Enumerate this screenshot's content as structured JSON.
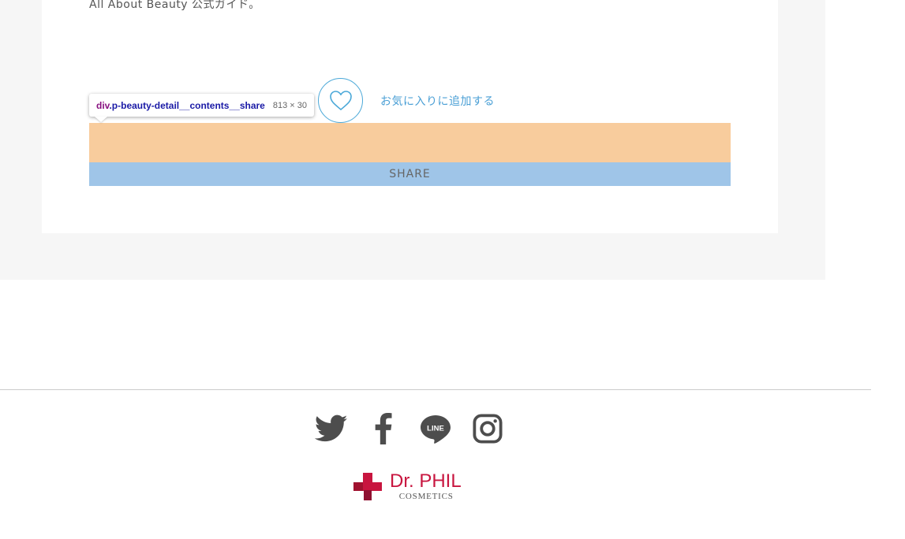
{
  "article": {
    "intro_text": "All About Beauty 公式ガイド。"
  },
  "favorite": {
    "label": "お気に入りに追加する",
    "icon": "heart-outline-icon",
    "accent_color": "#4a9fd5"
  },
  "share": {
    "label": "SHARE",
    "padding_color": "#f8cc9d",
    "bar_color": "#9fc5e8"
  },
  "inspector_tooltip": {
    "tag": "div",
    "class_name": ".p-beauty-detail__contents__share",
    "size": "813 × 30"
  },
  "footer": {
    "social_icons": [
      "twitter-icon",
      "facebook-icon",
      "line-icon",
      "instagram-icon"
    ],
    "icon_color": "#4d4d4d",
    "logo": {
      "main": "Dr. PHIL",
      "sub": "COSMETICS",
      "brand_color": "#c8153f"
    }
  }
}
